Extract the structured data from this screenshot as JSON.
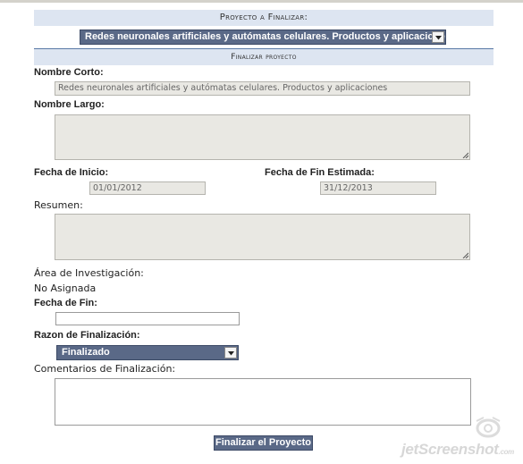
{
  "header": {
    "project_to_finish": "Proyecto a Finalizar:",
    "finish_section": "Finalizar proyecto"
  },
  "project_select": {
    "value": "Redes neuronales artificiales y autómatas celulares. Productos y aplicaciones"
  },
  "form": {
    "short_name_label": "Nombre Corto:",
    "short_name_value": "Redes neuronales artificiales y autómatas celulares. Productos y aplicaciones",
    "long_name_label": "Nombre Largo:",
    "long_name_value": "",
    "start_date_label": "Fecha de Inicio:",
    "start_date_value": "01/01/2012",
    "end_date_est_label": "Fecha de Fin Estimada:",
    "end_date_est_value": "31/12/2013",
    "summary_label": "Resumen:",
    "summary_value": "",
    "research_area_label": "Área de Investigación:",
    "research_area_value": "No Asignada",
    "end_date_label": "Fecha de Fin:",
    "end_date_value": "",
    "reason_label": "Razon de Finalización:",
    "reason_value": "Finalizado",
    "comments_label": "Comentarios de Finalización:",
    "comments_value": "",
    "submit_label": "Finalizar el Proyecto"
  },
  "watermark": {
    "text": "jetScreenshot",
    "suffix": ".com"
  }
}
